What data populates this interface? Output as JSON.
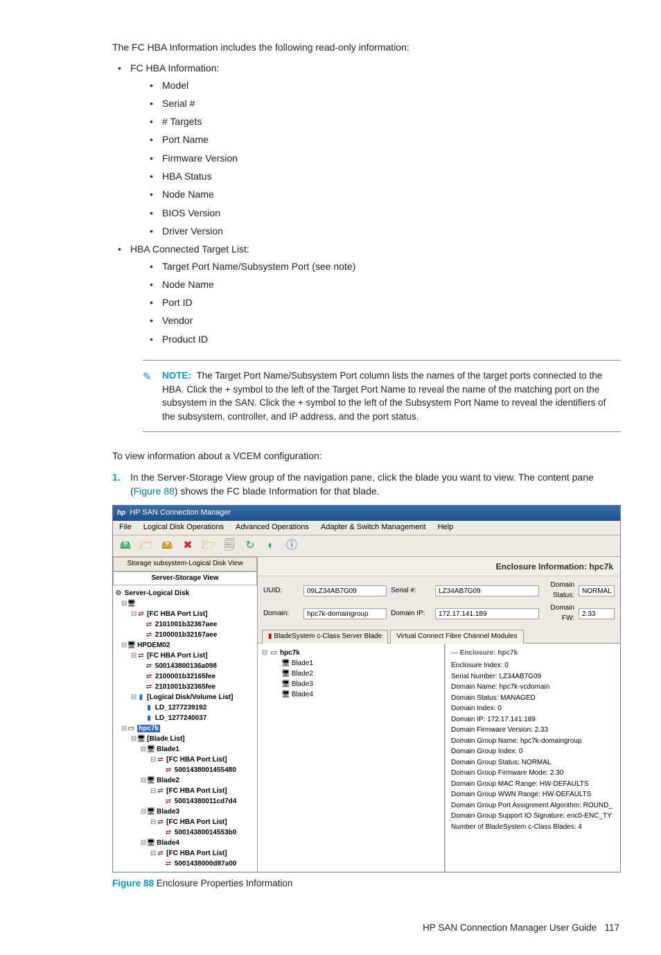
{
  "intro": "The FC HBA Information includes the following read-only information:",
  "list1_label": "FC HBA Information:",
  "list1": [
    "Model",
    "Serial #",
    "# Targets",
    "Port Name",
    "Firmware Version",
    "HBA Status",
    "Node Name",
    "BIOS Version",
    "Driver Version"
  ],
  "list2_label": "HBA Connected Target List:",
  "list2": [
    "Target Port Name/Subsystem Port (see note)",
    "Node Name",
    "Port ID",
    "Vendor",
    "Product ID"
  ],
  "note": {
    "label": "NOTE:",
    "text": "The Target Port Name/Subsystem Port column lists the names of the target ports connected to the HBA. Click the + symbol to the left of the Target Port Name to reveal the name of the matching port on the subsystem in the SAN. Click the + symbol to the left of the Subsystem Port Name to reveal the identifiers of the subsystem, controller, and IP address, and the port status."
  },
  "para2": "To view information about a VCEM configuration:",
  "step1": {
    "num": "1.",
    "text_a": "In the Server-Storage View group of the navigation pane, click the blade you want to view. The content pane (",
    "figref": "Figure 88",
    "text_b": ") shows the FC blade Information for that blade."
  },
  "app": {
    "title": "HP SAN Connection Manager",
    "menu": [
      "File",
      "Logical Disk Operations",
      "Advanced Operations",
      "Adapter & Switch Management",
      "Help"
    ],
    "view_tabs": [
      "Storage subsystem-Logical Disk View",
      "Server-Storage View"
    ],
    "tree_root": "Server-Logical Disk",
    "tree": {
      "n1": "[FC HBA Port List]",
      "n1a": "2101001b32367aee",
      "n1b": "2100001b32167aee",
      "n2": "HPDEM02",
      "n2a": "[FC HBA Port List]",
      "n2a1": "500143800136a098",
      "n2a2": "2100001b32165fee",
      "n2a3": "2101001b32365fee",
      "n2b": "[Logical Disk/Volume List]",
      "n2b1": "LD_1277239192",
      "n2b2": "LD_1277240037",
      "n3": "hpc7k",
      "n3a": "[Blade List]",
      "n3a1": "Blade1",
      "n3a1a": "[FC HBA Port List]",
      "n3a1a1": "5001438001455480",
      "n3a2": "Blade2",
      "n3a2a": "[FC HBA Port List]",
      "n3a2a1": "50014380011cd7d4",
      "n3a3": "Blade3",
      "n3a3a": "[FC HBA Port List]",
      "n3a3a1": "50014380014553b0",
      "n3a4": "Blade4",
      "n3a4a": "[FC HBA Port List]",
      "n3a4a1": "5001438000d87a00"
    },
    "content_header": "Enclosure Information: hpc7k",
    "info": {
      "uuid_l": "UUID:",
      "uuid_v": "09LZ34AB7G09",
      "serial_l": "Serial #:",
      "serial_v": "LZ34AB7G09",
      "dstat_l": "Domain Status:",
      "dstat_v": "NORMAL",
      "domain_l": "Domain:",
      "domain_v": "hpc7k-domaingroup",
      "dip_l": "Domain IP:",
      "dip_v": "172.17.141.189",
      "dfw_l": "Domain FW:",
      "dfw_v": "2.33"
    },
    "ctabs": [
      "BladeSystem c-Class Server Blade",
      "Virtual Connect Fibre Channel Modules"
    ],
    "mid_root": "hpc7k",
    "mid": [
      "Blade1",
      "Blade2",
      "Blade3",
      "Blade4"
    ],
    "detail_header": "Enclosure: hpc7k",
    "detail": [
      "Enclosure Index: 0",
      "Serial Number: LZ34AB7G09",
      "Domain Name: hpc7k-vcdomain",
      "Domain Status: MANAGED",
      "Domain Index: 0",
      "Domain IP: 172.17.141.189",
      "Domain Firmware Version: 2.33",
      "Domain Group Name: hpc7k-domaingroup",
      "Domain Group Index: 0",
      "Domain Group Status: NORMAL",
      "Domain Group Firmware Mode: 2.30",
      "Domain Group MAC Range: HW-DEFAULTS",
      "Domain Group WWN Range: HW-DEFAULTS",
      "Domain Group Port Assignment Algorithm: ROUND_",
      "Domain Group Support IO Signature: enc0-ENC_TY",
      "Number of BladeSystem c-Class Blades: 4"
    ]
  },
  "caption": {
    "label": "Figure 88",
    "text": " Enclosure Properties Information"
  },
  "footer": {
    "text": "HP SAN Connection Manager User Guide",
    "page": "117"
  }
}
